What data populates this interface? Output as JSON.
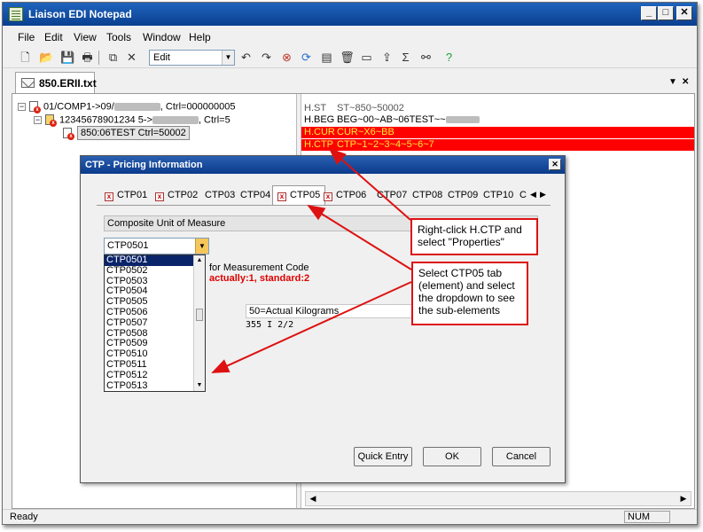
{
  "window": {
    "title": "Liaison EDI Notepad"
  },
  "menu": [
    "File",
    "Edit",
    "View",
    "Tools",
    "Window",
    "Help"
  ],
  "toolbar": {
    "combo_value": "Edit"
  },
  "doc_tab": {
    "label": "850.ERII.txt"
  },
  "tree": {
    "row1_a": "01/COMP1->09/",
    "row1_b": ", Ctrl=000000005",
    "row2_a": "12345678901234 5->",
    "row2_b": ", Ctrl=5",
    "row3": "850:06TEST Ctrl=50002"
  },
  "segments": [
    {
      "id": "H.ST",
      "value": "ST~850~50002"
    },
    {
      "id": "H.BEG",
      "value": "BEG~00~AB~06TEST~~"
    },
    {
      "id": "H.CUR",
      "value": "CUR~X6~BB"
    },
    {
      "id": "H.CTP",
      "value": "CTP~1~2~3~4~5~6~7"
    }
  ],
  "dialog": {
    "title": "CTP - Pricing Information",
    "tabs": [
      "CTP01",
      "CTP02",
      "CTP03",
      "CTP04",
      "CTP05",
      "CTP06",
      "CTP07",
      "CTP08",
      "CTP09",
      "CTP10",
      "C"
    ],
    "group_label": "Composite Unit of Measure",
    "dropdown_value": "CTP0501",
    "dropdown_items": [
      "CTP0501",
      "CTP0502",
      "CTP0503",
      "CTP0504",
      "CTP0505",
      "CTP0506",
      "CTP0507",
      "CTP0508",
      "CTP0509",
      "CTP0510",
      "CTP0511",
      "CTP0512",
      "CTP0513"
    ],
    "measurement_label": "for Measurement Code",
    "hint": "actually:1, standard:2",
    "value_field": "50=Actual Kilograms",
    "mono_line": "355 I 2/2",
    "quick_entry": "Quick Entry",
    "ok": "OK",
    "cancel": "Cancel"
  },
  "callouts": {
    "one": "Right-click H.CTP and select \"Properties\"",
    "two": "Select CTP05 tab (element) and select the dropdown to see the sub-elements"
  },
  "status": {
    "left": "Ready",
    "num": "NUM"
  },
  "colors": {
    "highlight_red": "#ff0000",
    "highlight_text": "#ffeb3b",
    "title_blue": "#0a3f8f",
    "callout_border": "#dd1111"
  }
}
